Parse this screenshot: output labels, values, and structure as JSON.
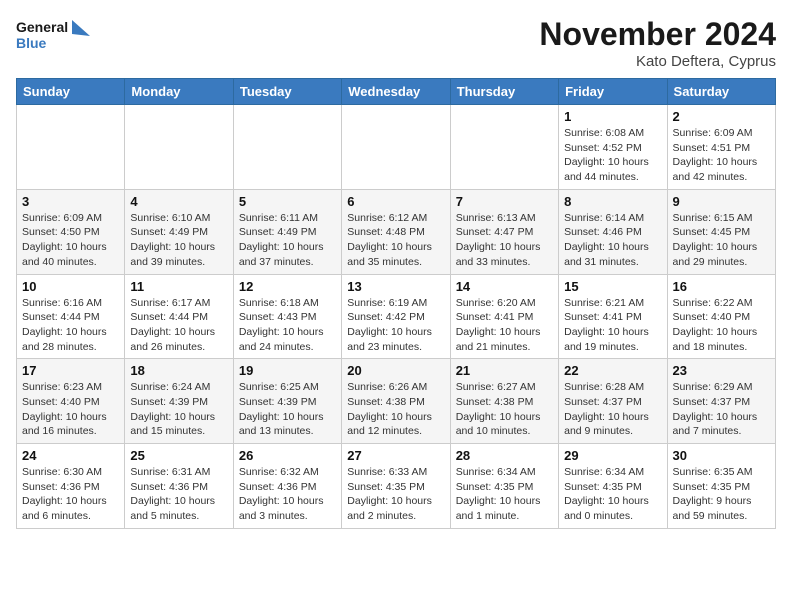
{
  "header": {
    "logo_line1": "General",
    "logo_line2": "Blue",
    "month_title": "November 2024",
    "location": "Kato Deftera, Cyprus"
  },
  "weekdays": [
    "Sunday",
    "Monday",
    "Tuesday",
    "Wednesday",
    "Thursday",
    "Friday",
    "Saturday"
  ],
  "weeks": [
    [
      {
        "day": "",
        "info": ""
      },
      {
        "day": "",
        "info": ""
      },
      {
        "day": "",
        "info": ""
      },
      {
        "day": "",
        "info": ""
      },
      {
        "day": "",
        "info": ""
      },
      {
        "day": "1",
        "info": "Sunrise: 6:08 AM\nSunset: 4:52 PM\nDaylight: 10 hours\nand 44 minutes."
      },
      {
        "day": "2",
        "info": "Sunrise: 6:09 AM\nSunset: 4:51 PM\nDaylight: 10 hours\nand 42 minutes."
      }
    ],
    [
      {
        "day": "3",
        "info": "Sunrise: 6:09 AM\nSunset: 4:50 PM\nDaylight: 10 hours\nand 40 minutes."
      },
      {
        "day": "4",
        "info": "Sunrise: 6:10 AM\nSunset: 4:49 PM\nDaylight: 10 hours\nand 39 minutes."
      },
      {
        "day": "5",
        "info": "Sunrise: 6:11 AM\nSunset: 4:49 PM\nDaylight: 10 hours\nand 37 minutes."
      },
      {
        "day": "6",
        "info": "Sunrise: 6:12 AM\nSunset: 4:48 PM\nDaylight: 10 hours\nand 35 minutes."
      },
      {
        "day": "7",
        "info": "Sunrise: 6:13 AM\nSunset: 4:47 PM\nDaylight: 10 hours\nand 33 minutes."
      },
      {
        "day": "8",
        "info": "Sunrise: 6:14 AM\nSunset: 4:46 PM\nDaylight: 10 hours\nand 31 minutes."
      },
      {
        "day": "9",
        "info": "Sunrise: 6:15 AM\nSunset: 4:45 PM\nDaylight: 10 hours\nand 29 minutes."
      }
    ],
    [
      {
        "day": "10",
        "info": "Sunrise: 6:16 AM\nSunset: 4:44 PM\nDaylight: 10 hours\nand 28 minutes."
      },
      {
        "day": "11",
        "info": "Sunrise: 6:17 AM\nSunset: 4:44 PM\nDaylight: 10 hours\nand 26 minutes."
      },
      {
        "day": "12",
        "info": "Sunrise: 6:18 AM\nSunset: 4:43 PM\nDaylight: 10 hours\nand 24 minutes."
      },
      {
        "day": "13",
        "info": "Sunrise: 6:19 AM\nSunset: 4:42 PM\nDaylight: 10 hours\nand 23 minutes."
      },
      {
        "day": "14",
        "info": "Sunrise: 6:20 AM\nSunset: 4:41 PM\nDaylight: 10 hours\nand 21 minutes."
      },
      {
        "day": "15",
        "info": "Sunrise: 6:21 AM\nSunset: 4:41 PM\nDaylight: 10 hours\nand 19 minutes."
      },
      {
        "day": "16",
        "info": "Sunrise: 6:22 AM\nSunset: 4:40 PM\nDaylight: 10 hours\nand 18 minutes."
      }
    ],
    [
      {
        "day": "17",
        "info": "Sunrise: 6:23 AM\nSunset: 4:40 PM\nDaylight: 10 hours\nand 16 minutes."
      },
      {
        "day": "18",
        "info": "Sunrise: 6:24 AM\nSunset: 4:39 PM\nDaylight: 10 hours\nand 15 minutes."
      },
      {
        "day": "19",
        "info": "Sunrise: 6:25 AM\nSunset: 4:39 PM\nDaylight: 10 hours\nand 13 minutes."
      },
      {
        "day": "20",
        "info": "Sunrise: 6:26 AM\nSunset: 4:38 PM\nDaylight: 10 hours\nand 12 minutes."
      },
      {
        "day": "21",
        "info": "Sunrise: 6:27 AM\nSunset: 4:38 PM\nDaylight: 10 hours\nand 10 minutes."
      },
      {
        "day": "22",
        "info": "Sunrise: 6:28 AM\nSunset: 4:37 PM\nDaylight: 10 hours\nand 9 minutes."
      },
      {
        "day": "23",
        "info": "Sunrise: 6:29 AM\nSunset: 4:37 PM\nDaylight: 10 hours\nand 7 minutes."
      }
    ],
    [
      {
        "day": "24",
        "info": "Sunrise: 6:30 AM\nSunset: 4:36 PM\nDaylight: 10 hours\nand 6 minutes."
      },
      {
        "day": "25",
        "info": "Sunrise: 6:31 AM\nSunset: 4:36 PM\nDaylight: 10 hours\nand 5 minutes."
      },
      {
        "day": "26",
        "info": "Sunrise: 6:32 AM\nSunset: 4:36 PM\nDaylight: 10 hours\nand 3 minutes."
      },
      {
        "day": "27",
        "info": "Sunrise: 6:33 AM\nSunset: 4:35 PM\nDaylight: 10 hours\nand 2 minutes."
      },
      {
        "day": "28",
        "info": "Sunrise: 6:34 AM\nSunset: 4:35 PM\nDaylight: 10 hours\nand 1 minute."
      },
      {
        "day": "29",
        "info": "Sunrise: 6:34 AM\nSunset: 4:35 PM\nDaylight: 10 hours\nand 0 minutes."
      },
      {
        "day": "30",
        "info": "Sunrise: 6:35 AM\nSunset: 4:35 PM\nDaylight: 9 hours\nand 59 minutes."
      }
    ]
  ]
}
